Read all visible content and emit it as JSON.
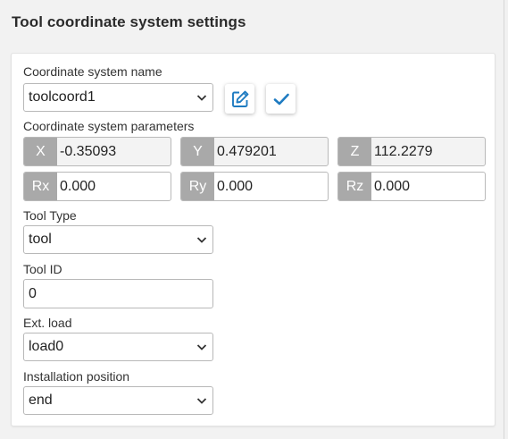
{
  "page": {
    "title": "Tool coordinate system settings"
  },
  "coord_name": {
    "label": "Coordinate system name",
    "selected": "toolcoord1"
  },
  "params": {
    "label": "Coordinate system parameters",
    "x": {
      "tag": "X",
      "value": "-0.35093"
    },
    "y": {
      "tag": "Y",
      "value": "0.479201"
    },
    "z": {
      "tag": "Z",
      "value": "112.2279"
    },
    "rx": {
      "tag": "Rx",
      "value": "0.000"
    },
    "ry": {
      "tag": "Ry",
      "value": "0.000"
    },
    "rz": {
      "tag": "Rz",
      "value": "0.000"
    }
  },
  "tool_type": {
    "label": "Tool Type",
    "selected": "tool"
  },
  "tool_id": {
    "label": "Tool ID",
    "value": "0"
  },
  "ext_load": {
    "label": "Ext. load",
    "selected": "load0"
  },
  "install_pos": {
    "label": "Installation position",
    "selected": "end"
  },
  "icons": {
    "edit": "edit-icon",
    "confirm": "check-icon",
    "dropdown": "chevron-down-icon"
  },
  "colors": {
    "accent": "#1e7bc1",
    "tag_bg": "#a9a9a9"
  }
}
